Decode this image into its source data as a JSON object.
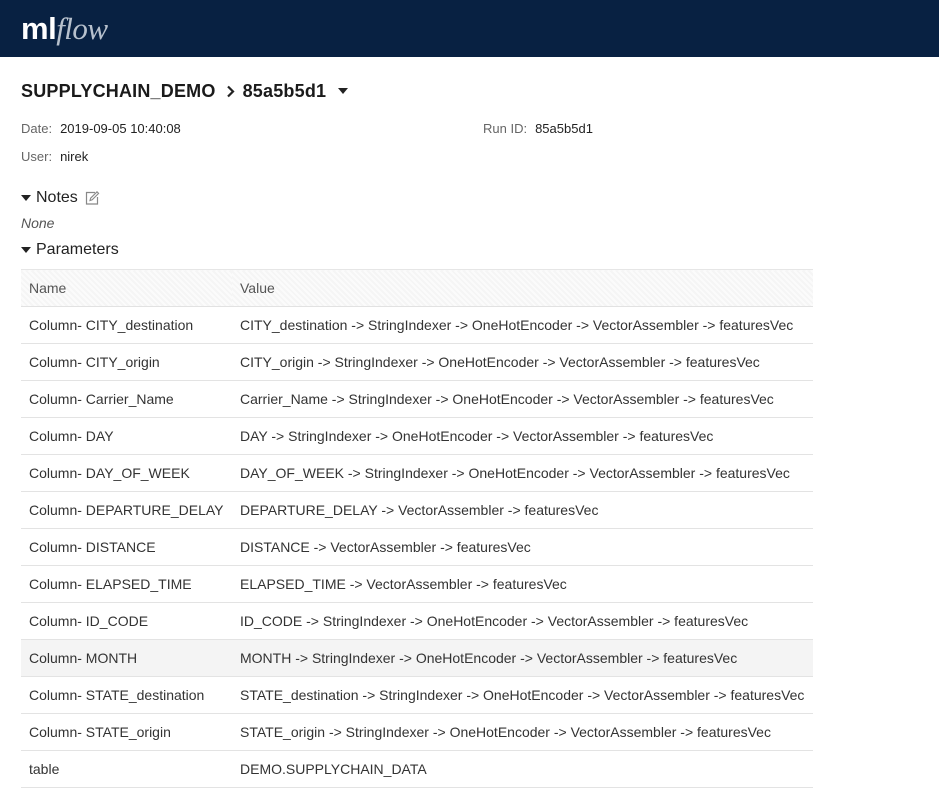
{
  "app": {
    "logo_ml": "ml",
    "logo_flow": "flow"
  },
  "breadcrumb": {
    "experiment": "SUPPLYCHAIN_DEMO",
    "run": "85a5b5d1"
  },
  "meta": {
    "date_label": "Date:",
    "date_value": "2019-09-05 10:40:08",
    "run_id_label": "Run ID:",
    "run_id_value": "85a5b5d1",
    "user_label": "User:",
    "user_value": "nirek"
  },
  "notes": {
    "title": "Notes",
    "content": "None"
  },
  "parameters": {
    "title": "Parameters",
    "headers": {
      "name": "Name",
      "value": "Value"
    },
    "rows": [
      {
        "name": "Column- CITY_destination",
        "value": "CITY_destination -> StringIndexer -> OneHotEncoder -> VectorAssembler -> featuresVec"
      },
      {
        "name": "Column- CITY_origin",
        "value": "CITY_origin -> StringIndexer -> OneHotEncoder -> VectorAssembler -> featuresVec"
      },
      {
        "name": "Column- Carrier_Name",
        "value": "Carrier_Name -> StringIndexer -> OneHotEncoder -> VectorAssembler -> featuresVec"
      },
      {
        "name": "Column- DAY",
        "value": "DAY -> StringIndexer -> OneHotEncoder -> VectorAssembler -> featuresVec"
      },
      {
        "name": "Column- DAY_OF_WEEK",
        "value": "DAY_OF_WEEK -> StringIndexer -> OneHotEncoder -> VectorAssembler -> featuresVec"
      },
      {
        "name": "Column- DEPARTURE_DELAY",
        "value": "DEPARTURE_DELAY -> VectorAssembler -> featuresVec"
      },
      {
        "name": "Column- DISTANCE",
        "value": "DISTANCE -> VectorAssembler -> featuresVec"
      },
      {
        "name": "Column- ELAPSED_TIME",
        "value": "ELAPSED_TIME -> VectorAssembler -> featuresVec"
      },
      {
        "name": "Column- ID_CODE",
        "value": "ID_CODE -> StringIndexer -> OneHotEncoder -> VectorAssembler -> featuresVec"
      },
      {
        "name": "Column- MONTH",
        "value": "MONTH -> StringIndexer -> OneHotEncoder -> VectorAssembler -> featuresVec"
      },
      {
        "name": "Column- STATE_destination",
        "value": "STATE_destination -> StringIndexer -> OneHotEncoder -> VectorAssembler -> featuresVec"
      },
      {
        "name": "Column- STATE_origin",
        "value": "STATE_origin -> StringIndexer -> OneHotEncoder -> VectorAssembler -> featuresVec"
      },
      {
        "name": "table",
        "value": "DEMO.SUPPLYCHAIN_DATA"
      }
    ]
  }
}
